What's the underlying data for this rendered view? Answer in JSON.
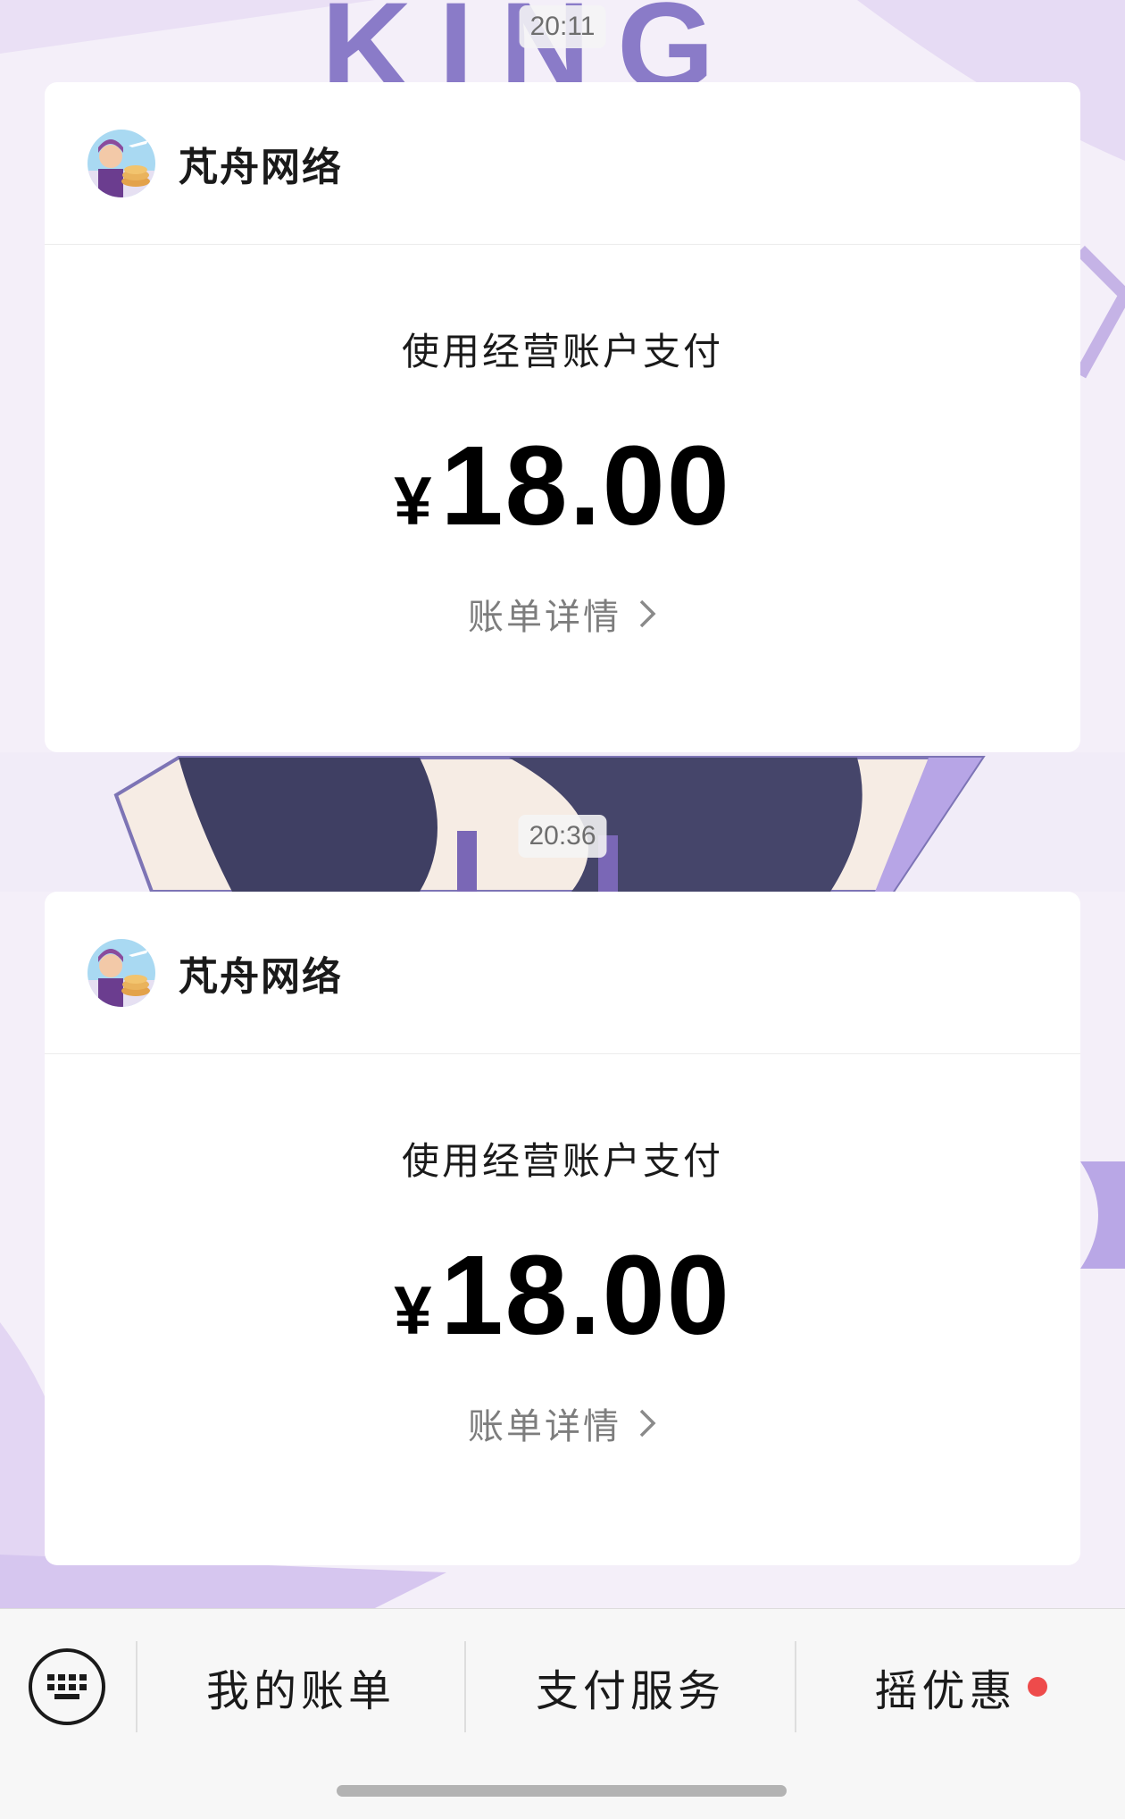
{
  "messages": [
    {
      "timestamp": "20:11",
      "merchant_name": "芃舟网络",
      "pay_method": "使用经营账户支付",
      "currency_symbol": "¥",
      "amount": "18.00",
      "detail_label": "账单详情"
    },
    {
      "timestamp": "20:36",
      "merchant_name": "芃舟网络",
      "pay_method": "使用经营账户支付",
      "currency_symbol": "¥",
      "amount": "18.00",
      "detail_label": "账单详情"
    }
  ],
  "bottom_menu": {
    "keyboard_icon": "keyboard-icon",
    "items": [
      "我的账单",
      "支付服务",
      "摇优惠"
    ],
    "badge_color": "#ee4b4b"
  },
  "wallpaper_text": "KING"
}
